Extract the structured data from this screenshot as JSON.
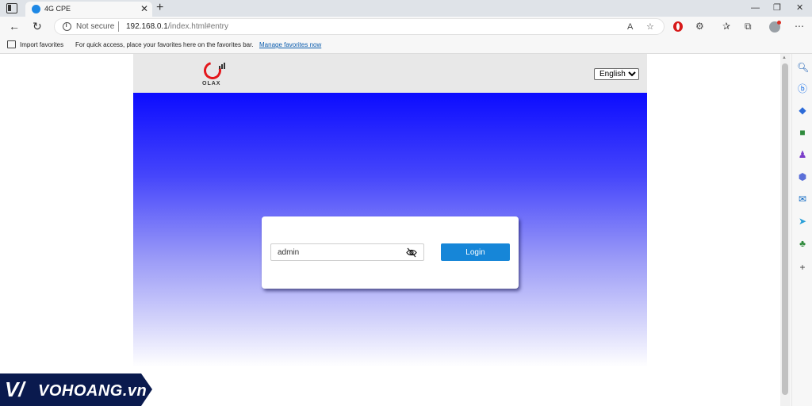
{
  "browser": {
    "tab_title": "4G CPE",
    "tab_close": "✕",
    "new_tab": "+",
    "window_controls": {
      "minimize": "—",
      "restore": "❐",
      "close": "✕"
    },
    "nav": {
      "back": "←",
      "reload": "↻"
    },
    "address": {
      "security_label": "Not secure",
      "url_host": "192.168.0.1",
      "url_path": "/index.html#entry"
    },
    "favorites_bar": {
      "import_label": "Import favorites",
      "hint_text": "For quick access, place your favorites here on the favorites bar.",
      "manage_link": "Manage favorites now"
    },
    "sidebar_icons": [
      "search-icon",
      "bing-chat-icon",
      "shopping-tag-icon",
      "toolbox-icon",
      "games-icon",
      "office-icon",
      "outlook-icon",
      "telegram-icon",
      "tree-icon",
      "add-icon"
    ]
  },
  "page": {
    "brand": {
      "logo_text": "OLAX",
      "color": "#e4171c"
    },
    "language": {
      "selected": "English"
    },
    "login": {
      "password_value": "admin",
      "button_label": "Login",
      "button_color": "#1686d8"
    },
    "banner_colors": {
      "top": "#0c0cff",
      "bottom": "#ffffff"
    }
  },
  "watermark": {
    "text": "VOHOANG.vn"
  }
}
